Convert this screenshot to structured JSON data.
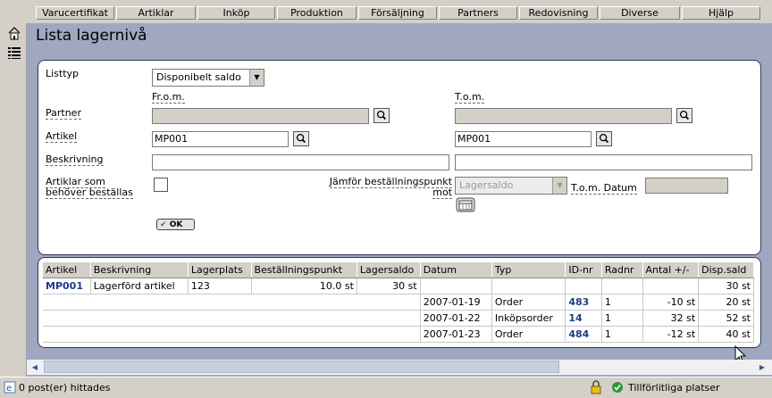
{
  "nav": {
    "tabs": [
      "Varucertifikat",
      "Artiklar",
      "Inköp",
      "Produktion",
      "Försäljning",
      "Partners",
      "Redovisning",
      "Diverse",
      "Hjälp"
    ]
  },
  "sidebar": {
    "icons": [
      "home-icon",
      "list-icon"
    ]
  },
  "page": {
    "title": "Lista lagernivå"
  },
  "filter": {
    "listtyp_label": "Listtyp",
    "listtyp_value": "Disponibelt saldo",
    "from_label": "Fr.o.m.",
    "to_label": "T.o.m.",
    "partner_label": "Partner",
    "partner_from": "",
    "partner_to": "",
    "artikel_label": "Artikel",
    "artikel_from": "MP001",
    "artikel_to": "MP001",
    "beskrivning_label": "Beskrivning",
    "beskrivning_from": "",
    "beskrivning_to": "",
    "behover_label_1": "Artiklar som",
    "behover_label_2": "behöver beställas",
    "jamfor_label_1": "Jämför beställningspunkt",
    "jamfor_label_2": "mot",
    "jamfor_value": "Lagersaldo",
    "tom_datum_label": "T.o.m. Datum",
    "tom_datum_value": "",
    "ok_label": "OK"
  },
  "table": {
    "headers": [
      "Artikel",
      "Beskrivning",
      "Lagerplats",
      "Beställningspunkt",
      "Lagersaldo",
      "Datum",
      "Typ",
      "ID-nr",
      "Radnr",
      "Antal +/-",
      "Disp.sald"
    ],
    "main_row": {
      "artikel": "MP001",
      "beskrivning": "Lagerförd artikel",
      "lagerplats": "123",
      "bestpunkt": "10.0 st",
      "lagersaldo": "30 st",
      "disp": "30 st"
    },
    "rows": [
      {
        "datum": "2007-01-19",
        "typ": "Order",
        "id": "483",
        "radnr": "1",
        "antal": "-10 st",
        "disp": "20 st"
      },
      {
        "datum": "2007-01-22",
        "typ": "Inköpsorder",
        "id": "14",
        "radnr": "1",
        "antal": "32 st",
        "disp": "52 st"
      },
      {
        "datum": "2007-01-23",
        "typ": "Order",
        "id": "484",
        "radnr": "1",
        "antal": "-12 st",
        "disp": "40 st"
      }
    ]
  },
  "status": {
    "left": "0 post(er) hittades",
    "right": "Tillförlitliga platser"
  }
}
